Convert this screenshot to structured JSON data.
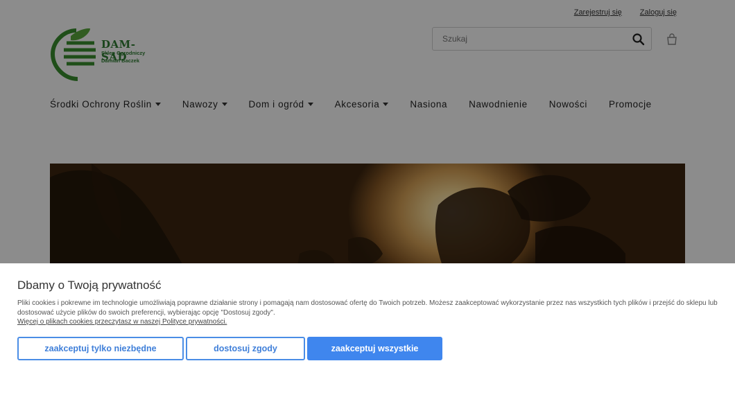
{
  "header": {
    "register_label": "Zarejestruj się",
    "login_label": "Zaloguj się",
    "search_placeholder": "Szukaj"
  },
  "logo": {
    "title": "DAM-SAD",
    "subtitle_1": "Sklep Ogrodniczy",
    "subtitle_2": "Damian Baczek"
  },
  "nav": {
    "items": [
      {
        "label": "Środki Ochrony Roślin",
        "dropdown": true
      },
      {
        "label": "Nawozy",
        "dropdown": true
      },
      {
        "label": "Dom i ogród",
        "dropdown": true
      },
      {
        "label": "Akcesoria",
        "dropdown": true
      },
      {
        "label": "Nasiona",
        "dropdown": false
      },
      {
        "label": "Nawodnienie",
        "dropdown": false
      },
      {
        "label": "Nowości",
        "dropdown": false
      },
      {
        "label": "Promocje",
        "dropdown": false
      }
    ]
  },
  "cookie": {
    "title": "Dbamy o Twoją prywatność",
    "text": "Pliki cookies i pokrewne im technologie umożliwiają poprawne działanie strony i pomagają nam dostosować ofertę do Twoich potrzeb. Możesz zaakceptować wykorzystanie przez nas wszystkich tych plików i przejść do sklepu lub dostosować użycie plików do swoich preferencji, wybierając opcję \"Dostosuj zgody\".",
    "link": "Więcej o plikach cookies przeczytasz w naszej Polityce prywatności.",
    "btn_necessary": "zaakceptuj tylko niezbędne",
    "btn_customize": "dostosuj zgody",
    "btn_accept_all": "zaakceptuj wszystkie"
  },
  "colors": {
    "accent": "#3f86ee",
    "brand_green": "#2e7d32"
  }
}
